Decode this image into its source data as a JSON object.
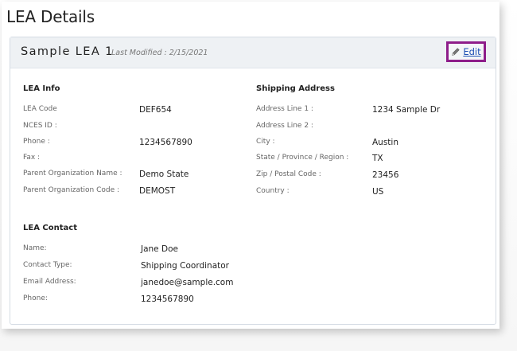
{
  "page": {
    "title": "LEA Details"
  },
  "card": {
    "title": "Sample LEA 1",
    "last_modified": "Last Modified : 2/15/2021",
    "edit_label": "Edit"
  },
  "icons": {
    "edit": "pencil-icon"
  },
  "colors": {
    "highlight_border": "#8e1d8a",
    "link": "#1e50b4",
    "header_bg": "#eef1f4"
  },
  "lea_info": {
    "title": "LEA Info",
    "rows": [
      {
        "label": "LEA Code",
        "value": "DEF654"
      },
      {
        "label": "NCES ID :",
        "value": ""
      },
      {
        "label": "Phone :",
        "value": "1234567890"
      },
      {
        "label": "Fax :",
        "value": ""
      },
      {
        "label": "Parent Organization Name :",
        "value": "Demo State"
      },
      {
        "label": "Parent Organization Code :",
        "value": "DEMOST"
      }
    ]
  },
  "shipping": {
    "title": "Shipping Address",
    "rows": [
      {
        "label": "Address Line 1 :",
        "value": "1234 Sample Dr"
      },
      {
        "label": "Address Line 2 :",
        "value": ""
      },
      {
        "label": "City :",
        "value": "Austin"
      },
      {
        "label": "State / Province / Region :",
        "value": "TX"
      },
      {
        "label": "Zip / Postal Code :",
        "value": "23456"
      },
      {
        "label": "Country :",
        "value": "US"
      }
    ]
  },
  "lea_contact": {
    "title": "LEA Contact",
    "rows": [
      {
        "label": "Name:",
        "value": "Jane Doe"
      },
      {
        "label": "Contact Type:",
        "value": "Shipping Coordinator"
      },
      {
        "label": "Email Address:",
        "value": "janedoe@sample.com"
      },
      {
        "label": "Phone:",
        "value": "1234567890"
      }
    ]
  }
}
